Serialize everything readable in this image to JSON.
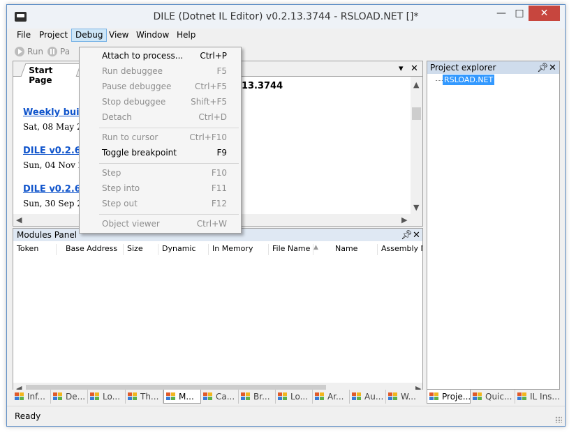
{
  "window": {
    "title": "DILE (Dotnet IL Editor) v0.2.13.3744 - RSLOAD.NET []*"
  },
  "menu": [
    "File",
    "Project",
    "Debug",
    "View",
    "Window",
    "Help"
  ],
  "toolbar": {
    "run": "Run",
    "pause": "Pa"
  },
  "doc": {
    "tab": "Start Page",
    "version_head": ".13.3744",
    "news": [
      {
        "title": "Weekly bui",
        "date": "Sat, 08 May 2"
      },
      {
        "title": "DILE v0.2.6",
        "date": "Sun, 04 Nov 2"
      },
      {
        "title": "DILE v0.2.6",
        "date": "Sun, 30 Sep 2"
      }
    ]
  },
  "debug_menu": [
    {
      "label": "Attach to process...",
      "shortcut": "Ctrl+P",
      "enabled": true
    },
    {
      "label": "Run debuggee",
      "shortcut": "F5",
      "enabled": false
    },
    {
      "label": "Pause debuggee",
      "shortcut": "Ctrl+F5",
      "enabled": false
    },
    {
      "label": "Stop debuggee",
      "shortcut": "Shift+F5",
      "enabled": false
    },
    {
      "label": "Detach",
      "shortcut": "Ctrl+D",
      "enabled": false
    },
    {
      "label": "Run to cursor",
      "shortcut": "Ctrl+F10",
      "enabled": false
    },
    {
      "label": "Toggle breakpoint",
      "shortcut": "F9",
      "enabled": true
    },
    {
      "label": "Step",
      "shortcut": "F10",
      "enabled": false
    },
    {
      "label": "Step into",
      "shortcut": "F11",
      "enabled": false
    },
    {
      "label": "Step out",
      "shortcut": "F12",
      "enabled": false
    },
    {
      "label": "Object viewer",
      "shortcut": "Ctrl+W",
      "enabled": false
    }
  ],
  "modules": {
    "title": "Modules Panel",
    "columns": [
      "Token",
      "Base Address",
      "Size",
      "Dynamic",
      "In Memory",
      "File Name",
      "Name",
      "Assembly Na"
    ]
  },
  "bottom_tabs": [
    "Inf...",
    "De...",
    "Lo...",
    "Th...",
    "M...",
    "Ca...",
    "Br...",
    "Lo...",
    "Ar...",
    "Au...",
    "W..."
  ],
  "project": {
    "title": "Project explorer",
    "node": "RSLOAD.NET",
    "tabs": [
      "Proje...",
      "Quic...",
      "IL Ins..."
    ]
  },
  "status": {
    "text": "Ready"
  },
  "colors": {
    "close_button": "#c7463e",
    "selection": "#3399ff",
    "link": "#1155cc"
  }
}
